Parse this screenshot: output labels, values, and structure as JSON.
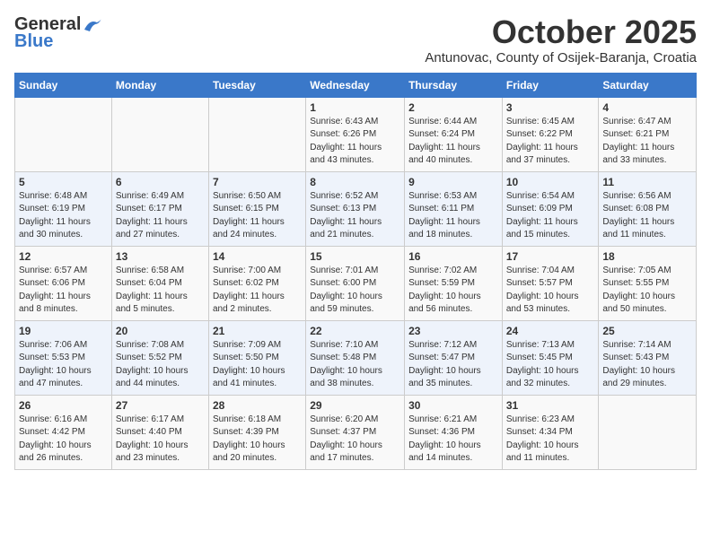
{
  "header": {
    "logo_general": "General",
    "logo_blue": "Blue",
    "title": "October 2025",
    "subtitle": "Antunovac, County of Osijek-Baranja, Croatia"
  },
  "days_of_week": [
    "Sunday",
    "Monday",
    "Tuesday",
    "Wednesday",
    "Thursday",
    "Friday",
    "Saturday"
  ],
  "weeks": [
    [
      {
        "day": "",
        "info": ""
      },
      {
        "day": "",
        "info": ""
      },
      {
        "day": "",
        "info": ""
      },
      {
        "day": "1",
        "info": "Sunrise: 6:43 AM\nSunset: 6:26 PM\nDaylight: 11 hours\nand 43 minutes."
      },
      {
        "day": "2",
        "info": "Sunrise: 6:44 AM\nSunset: 6:24 PM\nDaylight: 11 hours\nand 40 minutes."
      },
      {
        "day": "3",
        "info": "Sunrise: 6:45 AM\nSunset: 6:22 PM\nDaylight: 11 hours\nand 37 minutes."
      },
      {
        "day": "4",
        "info": "Sunrise: 6:47 AM\nSunset: 6:21 PM\nDaylight: 11 hours\nand 33 minutes."
      }
    ],
    [
      {
        "day": "5",
        "info": "Sunrise: 6:48 AM\nSunset: 6:19 PM\nDaylight: 11 hours\nand 30 minutes."
      },
      {
        "day": "6",
        "info": "Sunrise: 6:49 AM\nSunset: 6:17 PM\nDaylight: 11 hours\nand 27 minutes."
      },
      {
        "day": "7",
        "info": "Sunrise: 6:50 AM\nSunset: 6:15 PM\nDaylight: 11 hours\nand 24 minutes."
      },
      {
        "day": "8",
        "info": "Sunrise: 6:52 AM\nSunset: 6:13 PM\nDaylight: 11 hours\nand 21 minutes."
      },
      {
        "day": "9",
        "info": "Sunrise: 6:53 AM\nSunset: 6:11 PM\nDaylight: 11 hours\nand 18 minutes."
      },
      {
        "day": "10",
        "info": "Sunrise: 6:54 AM\nSunset: 6:09 PM\nDaylight: 11 hours\nand 15 minutes."
      },
      {
        "day": "11",
        "info": "Sunrise: 6:56 AM\nSunset: 6:08 PM\nDaylight: 11 hours\nand 11 minutes."
      }
    ],
    [
      {
        "day": "12",
        "info": "Sunrise: 6:57 AM\nSunset: 6:06 PM\nDaylight: 11 hours\nand 8 minutes."
      },
      {
        "day": "13",
        "info": "Sunrise: 6:58 AM\nSunset: 6:04 PM\nDaylight: 11 hours\nand 5 minutes."
      },
      {
        "day": "14",
        "info": "Sunrise: 7:00 AM\nSunset: 6:02 PM\nDaylight: 11 hours\nand 2 minutes."
      },
      {
        "day": "15",
        "info": "Sunrise: 7:01 AM\nSunset: 6:00 PM\nDaylight: 10 hours\nand 59 minutes."
      },
      {
        "day": "16",
        "info": "Sunrise: 7:02 AM\nSunset: 5:59 PM\nDaylight: 10 hours\nand 56 minutes."
      },
      {
        "day": "17",
        "info": "Sunrise: 7:04 AM\nSunset: 5:57 PM\nDaylight: 10 hours\nand 53 minutes."
      },
      {
        "day": "18",
        "info": "Sunrise: 7:05 AM\nSunset: 5:55 PM\nDaylight: 10 hours\nand 50 minutes."
      }
    ],
    [
      {
        "day": "19",
        "info": "Sunrise: 7:06 AM\nSunset: 5:53 PM\nDaylight: 10 hours\nand 47 minutes."
      },
      {
        "day": "20",
        "info": "Sunrise: 7:08 AM\nSunset: 5:52 PM\nDaylight: 10 hours\nand 44 minutes."
      },
      {
        "day": "21",
        "info": "Sunrise: 7:09 AM\nSunset: 5:50 PM\nDaylight: 10 hours\nand 41 minutes."
      },
      {
        "day": "22",
        "info": "Sunrise: 7:10 AM\nSunset: 5:48 PM\nDaylight: 10 hours\nand 38 minutes."
      },
      {
        "day": "23",
        "info": "Sunrise: 7:12 AM\nSunset: 5:47 PM\nDaylight: 10 hours\nand 35 minutes."
      },
      {
        "day": "24",
        "info": "Sunrise: 7:13 AM\nSunset: 5:45 PM\nDaylight: 10 hours\nand 32 minutes."
      },
      {
        "day": "25",
        "info": "Sunrise: 7:14 AM\nSunset: 5:43 PM\nDaylight: 10 hours\nand 29 minutes."
      }
    ],
    [
      {
        "day": "26",
        "info": "Sunrise: 6:16 AM\nSunset: 4:42 PM\nDaylight: 10 hours\nand 26 minutes."
      },
      {
        "day": "27",
        "info": "Sunrise: 6:17 AM\nSunset: 4:40 PM\nDaylight: 10 hours\nand 23 minutes."
      },
      {
        "day": "28",
        "info": "Sunrise: 6:18 AM\nSunset: 4:39 PM\nDaylight: 10 hours\nand 20 minutes."
      },
      {
        "day": "29",
        "info": "Sunrise: 6:20 AM\nSunset: 4:37 PM\nDaylight: 10 hours\nand 17 minutes."
      },
      {
        "day": "30",
        "info": "Sunrise: 6:21 AM\nSunset: 4:36 PM\nDaylight: 10 hours\nand 14 minutes."
      },
      {
        "day": "31",
        "info": "Sunrise: 6:23 AM\nSunset: 4:34 PM\nDaylight: 10 hours\nand 11 minutes."
      },
      {
        "day": "",
        "info": ""
      }
    ]
  ]
}
